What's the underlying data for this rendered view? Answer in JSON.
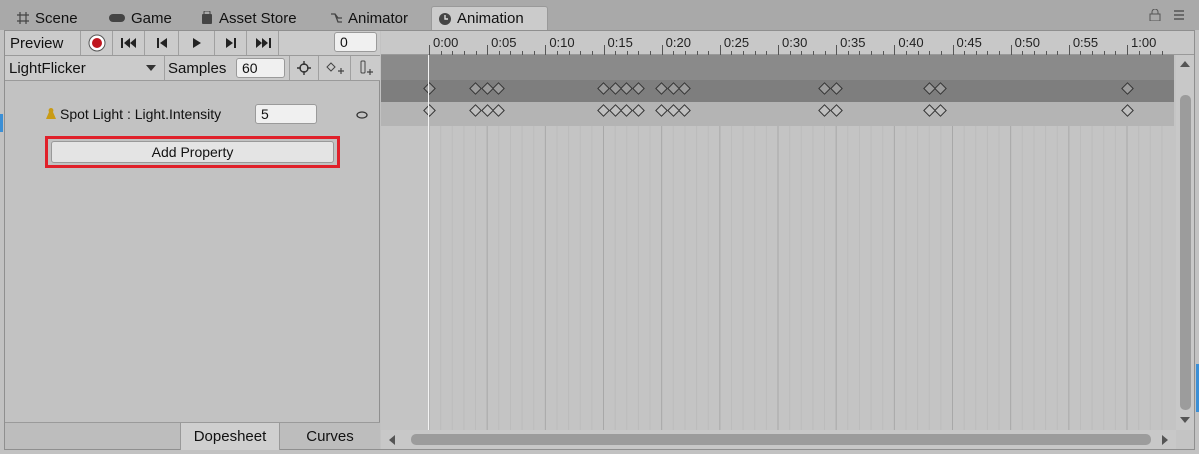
{
  "tabs": [
    {
      "label": "Scene",
      "icon": "grid-icon"
    },
    {
      "label": "Game",
      "icon": "gamepad-icon"
    },
    {
      "label": "Asset Store",
      "icon": "bag-icon"
    },
    {
      "label": "Animator",
      "icon": "branch-icon"
    },
    {
      "label": "Animation",
      "icon": "clock-icon",
      "active": true
    }
  ],
  "toolbar": {
    "preview_label": "Preview",
    "frame_value": "0",
    "clip_name": "LightFlicker",
    "samples_label": "Samples",
    "samples_value": "60"
  },
  "property": {
    "label": "Spot Light : Light.Intensity",
    "value": "5"
  },
  "add_property_label": "Add Property",
  "bottom_tabs": {
    "dopesheet": "Dopesheet",
    "curves": "Curves"
  },
  "timeline": {
    "ticks": [
      "0:00",
      "0:05",
      "0:10",
      "0:15",
      "0:20",
      "0:25",
      "0:30",
      "0:35",
      "0:40",
      "0:45",
      "0:50",
      "0:55",
      "1:00"
    ],
    "keyframe_times": [
      "0:00",
      "0:04",
      "0:05",
      "0:06",
      "0:15",
      "0:16",
      "0:17",
      "0:18",
      "0:20",
      "0:21",
      "0:22",
      "0:34",
      "0:35",
      "0:43",
      "0:44",
      "1:00"
    ]
  },
  "colors": {
    "record": "#c0161f",
    "highlight": "#e0202a"
  }
}
